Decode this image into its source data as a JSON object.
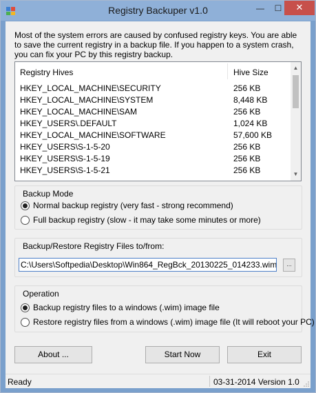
{
  "window": {
    "title": "Registry Backuper v1.0",
    "min_glyph": "—",
    "max_glyph": "☐",
    "close_glyph": "✕"
  },
  "intro_text": "Most of the system errors are caused by confused registry keys. You are able to save the current registry in a backup file. If you happen to a system crash, you can fix your PC by this registry backup.",
  "hives_list": {
    "columns": [
      "Registry Hives",
      "Hive Size"
    ],
    "rows": [
      {
        "name": "HKEY_LOCAL_MACHINE\\SECURITY",
        "size": "256 KB"
      },
      {
        "name": "HKEY_LOCAL_MACHINE\\SYSTEM",
        "size": "8,448 KB"
      },
      {
        "name": "HKEY_LOCAL_MACHINE\\SAM",
        "size": "256 KB"
      },
      {
        "name": "HKEY_USERS\\.DEFAULT",
        "size": "1,024 KB"
      },
      {
        "name": "HKEY_LOCAL_MACHINE\\SOFTWARE",
        "size": "57,600 KB"
      },
      {
        "name": "HKEY_USERS\\S-1-5-20",
        "size": "256 KB"
      },
      {
        "name": "HKEY_USERS\\S-1-5-19",
        "size": "256 KB"
      },
      {
        "name": "HKEY_USERS\\S-1-5-21",
        "size": "256 KB"
      }
    ],
    "scroll_up_glyph": "▲",
    "scroll_down_glyph": "▼"
  },
  "backup_mode": {
    "legend": "Backup Mode",
    "options": [
      {
        "label": "Normal backup registry (very fast - strong recommend)",
        "selected": true
      },
      {
        "label": "Full backup registry (slow - it may take some minutes or more)",
        "selected": false
      }
    ]
  },
  "path_group": {
    "legend": "Backup/Restore Registry Files to/from:",
    "path_value": "C:\\Users\\Softpedia\\Desktop\\Win864_RegBck_20130225_014233.wim",
    "browse_label": "..."
  },
  "operation": {
    "legend": "Operation",
    "options": [
      {
        "label": "Backup registry files to a windows (.wim) image file",
        "selected": true
      },
      {
        "label": "Restore registry files from a windows (.wim) image file (It will reboot your PC)",
        "selected": false
      }
    ]
  },
  "buttons": {
    "about": "About ...",
    "start": "Start Now",
    "exit": "Exit"
  },
  "status": {
    "left": "Ready",
    "right": "03-31-2014 Version 1.0"
  }
}
